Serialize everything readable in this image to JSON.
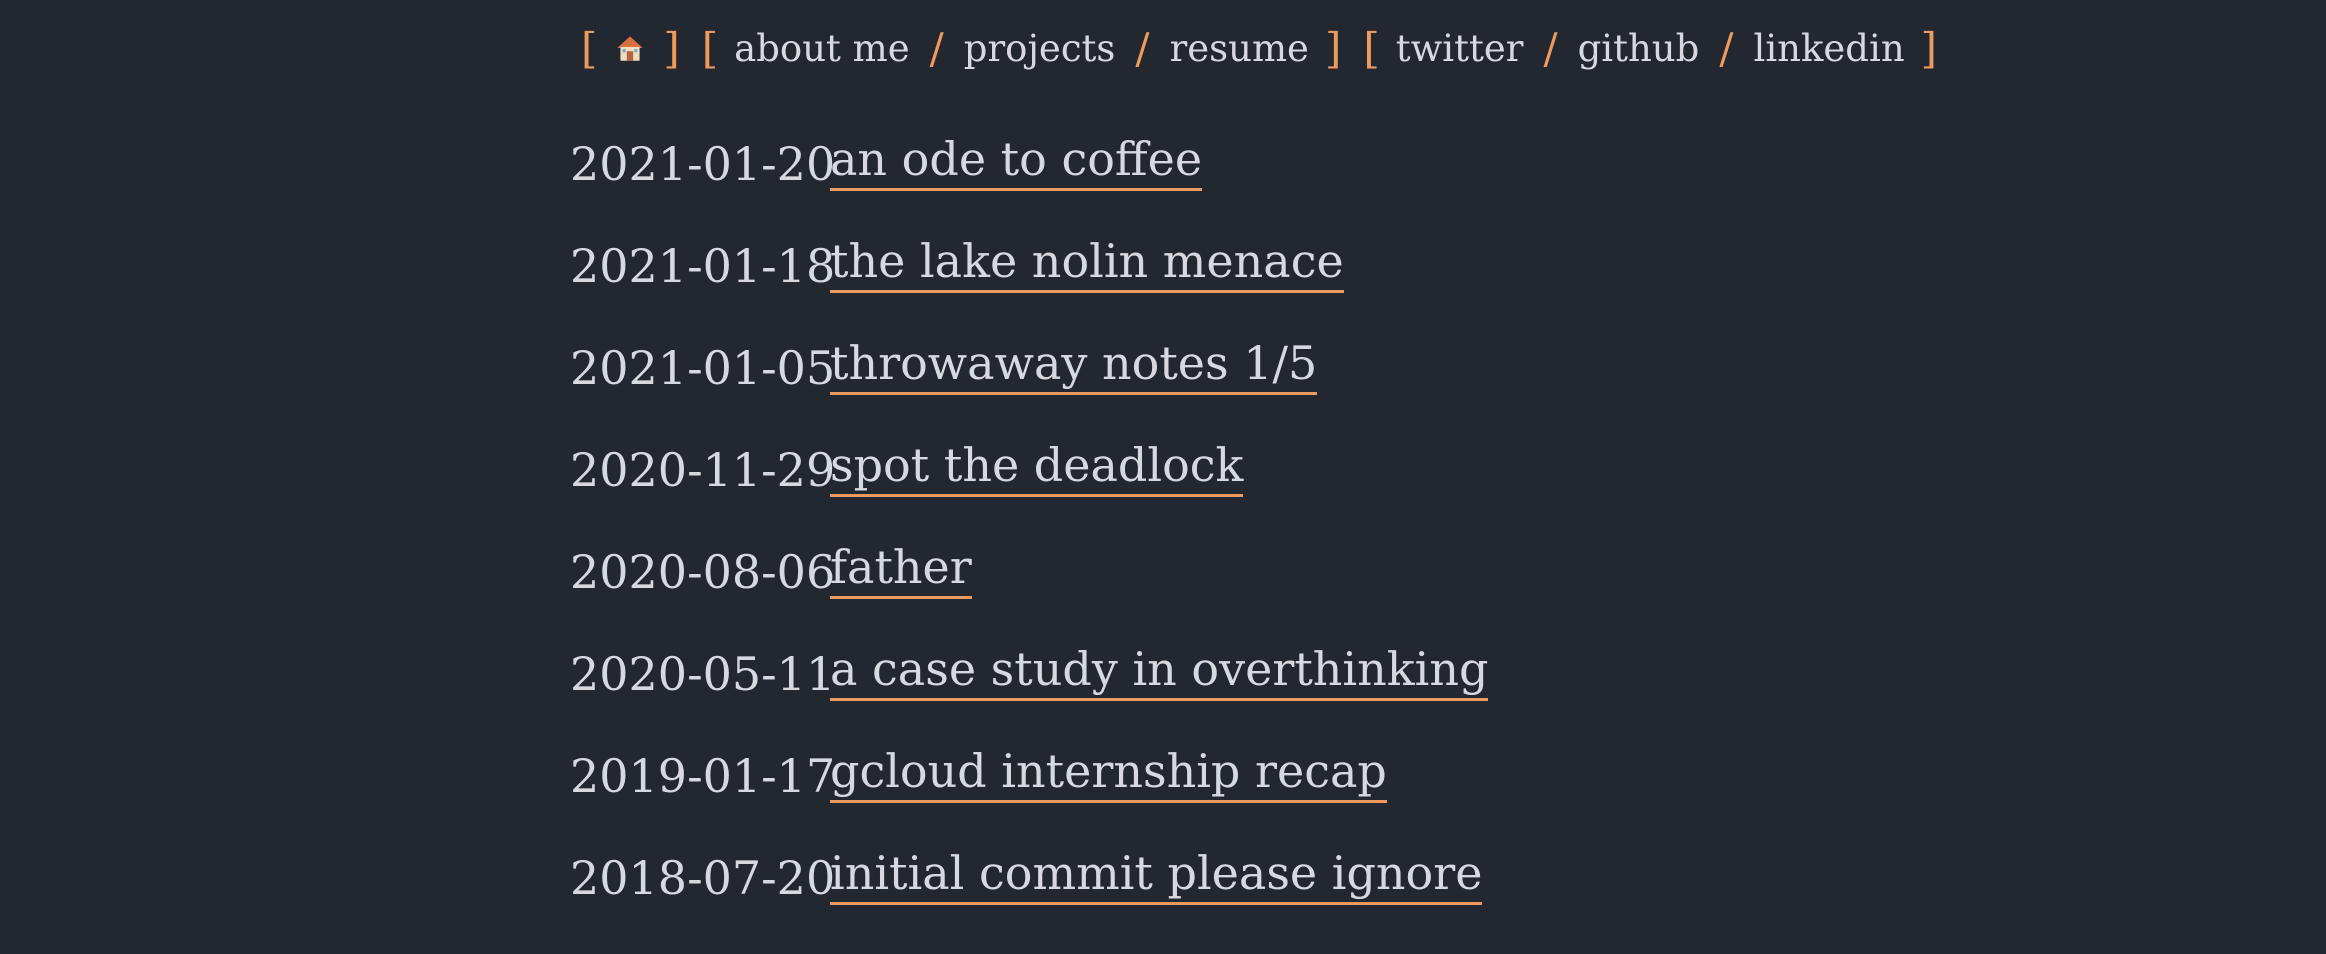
{
  "nav": {
    "home_icon": "house-icon",
    "links": [
      "about me",
      "projects",
      "resume"
    ],
    "socials": [
      "twitter",
      "github",
      "linkedin"
    ],
    "bracket_open": "[",
    "bracket_close": "]",
    "separator": "/",
    "accent_color": "#ee9a5c"
  },
  "posts": [
    {
      "date": "2021-01-20",
      "title": "an ode to coffee"
    },
    {
      "date": "2021-01-18",
      "title": "the lake nolin menace"
    },
    {
      "date": "2021-01-05",
      "title": "throwaway notes 1/5"
    },
    {
      "date": "2020-11-29",
      "title": "spot the deadlock"
    },
    {
      "date": "2020-08-06",
      "title": "father"
    },
    {
      "date": "2020-05-11",
      "title": "a case study in overthinking"
    },
    {
      "date": "2019-01-17",
      "title": "gcloud internship recap"
    },
    {
      "date": "2018-07-20",
      "title": "initial commit please ignore"
    }
  ],
  "colors": {
    "background": "#232730",
    "text": "#d7d9df",
    "accent": "#ee9a5c"
  }
}
